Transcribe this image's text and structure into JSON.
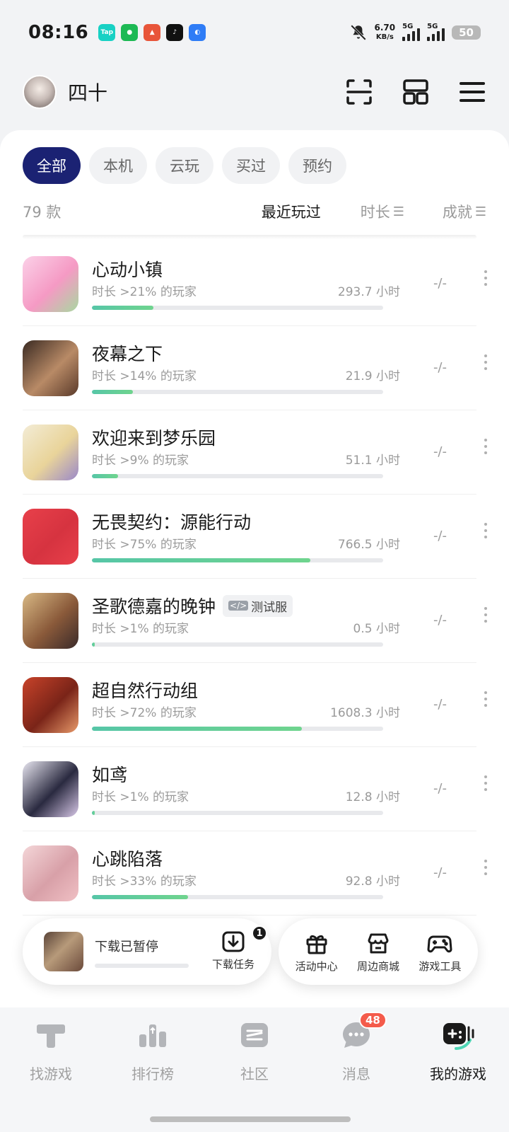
{
  "status_bar": {
    "time": "08:16",
    "net_speed_value": "6.70",
    "net_speed_unit": "KB/s",
    "signal1_label": "5G",
    "signal2_label": "5G",
    "battery": "50",
    "app_icons": [
      "taptap-icon",
      "wechat-icon",
      "game-app-icon",
      "tiktok-icon",
      "browser-icon"
    ]
  },
  "header": {
    "username": "四十",
    "icons": [
      "scan-icon",
      "grid-icon",
      "menu-icon"
    ]
  },
  "filters": {
    "items": [
      "全部",
      "本机",
      "云玩",
      "买过",
      "预约"
    ],
    "active": 0
  },
  "sortbar": {
    "count": "79 款",
    "recent": "最近玩过",
    "duration": "时长",
    "achievement": "成就"
  },
  "games": [
    {
      "name": "心动小镇",
      "sub": "时长 >21% 的玩家",
      "hours": "293.7 小时",
      "ach": "-/-",
      "progress": 0.21,
      "badge": "",
      "colors": [
        "#fbd1e8",
        "#f59ac4",
        "#a8d8a0"
      ]
    },
    {
      "name": "夜幕之下",
      "sub": "时长 >14% 的玩家",
      "hours": "21.9 小时",
      "ach": "-/-",
      "progress": 0.14,
      "badge": "",
      "colors": [
        "#3a2a22",
        "#b88a66",
        "#5a3a2a"
      ]
    },
    {
      "name": "欢迎来到梦乐园",
      "sub": "时长 >9% 的玩家",
      "hours": "51.1 小时",
      "ach": "-/-",
      "progress": 0.09,
      "badge": "",
      "colors": [
        "#f3ecd6",
        "#e9d49a",
        "#9a88c8"
      ]
    },
    {
      "name": "无畏契约：源能行动",
      "sub": "时长 >75% 的玩家",
      "hours": "766.5 小时",
      "ach": "-/-",
      "progress": 0.75,
      "badge": "",
      "colors": [
        "#e8404a",
        "#d63340",
        "#e8404a"
      ]
    },
    {
      "name": "圣歌德嘉的晚钟",
      "sub": "时长 >1% 的玩家",
      "hours": "0.5 小时",
      "ach": "-/-",
      "progress": 0.01,
      "badge": "测试服",
      "colors": [
        "#d8b884",
        "#8a5a3a",
        "#3a2a2a"
      ]
    },
    {
      "name": "超自然行动组",
      "sub": "时长 >72% 的玩家",
      "hours": "1608.3 小时",
      "ach": "-/-",
      "progress": 0.72,
      "badge": "",
      "colors": [
        "#c8432a",
        "#7a2418",
        "#e89a6a"
      ]
    },
    {
      "name": "如鸢",
      "sub": "时长 >1% 的玩家",
      "hours": "12.8 小时",
      "ach": "-/-",
      "progress": 0.01,
      "badge": "",
      "colors": [
        "#e8e6f0",
        "#2a2a40",
        "#d8c8e8"
      ]
    },
    {
      "name": "心跳陷落",
      "sub": "时长 >33% 的玩家",
      "hours": "92.8 小时",
      "ach": "-/-",
      "progress": 0.33,
      "badge": "",
      "colors": [
        "#f4d6d8",
        "#d8a0a8",
        "#f0c0c4"
      ]
    }
  ],
  "download_widget": {
    "status": "下载已暂停",
    "task_label": "下载任务",
    "task_count": "1"
  },
  "tools": [
    {
      "label": "活动中心",
      "icon": "gift-icon"
    },
    {
      "label": "周边商城",
      "icon": "shop-icon"
    },
    {
      "label": "游戏工具",
      "icon": "gamepad-icon"
    }
  ],
  "bottom_nav": [
    {
      "label": "找游戏",
      "icon": "discover-icon"
    },
    {
      "label": "排行榜",
      "icon": "ranking-icon"
    },
    {
      "label": "社区",
      "icon": "community-icon"
    },
    {
      "label": "消息",
      "icon": "message-icon",
      "badge": "48"
    },
    {
      "label": "我的游戏",
      "icon": "my-games-icon",
      "active": true
    }
  ]
}
